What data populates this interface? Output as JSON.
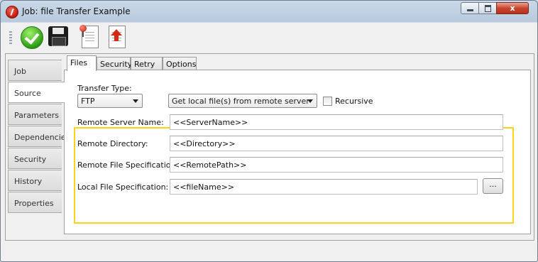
{
  "window": {
    "title": "Job: file Transfer Example",
    "close_label": "x"
  },
  "toolbar": {
    "buttons": [
      "ok-icon",
      "save-icon",
      "document-pin-icon",
      "document-upload-icon"
    ]
  },
  "side_tabs": [
    "Job",
    "Source",
    "Parameters",
    "Dependencies",
    "Security",
    "History",
    "Properties"
  ],
  "active_side_tab": "Source",
  "top_tabs": [
    "Files",
    "Security",
    "Retry",
    "Options"
  ],
  "active_top_tab": "Files",
  "form": {
    "transfer_type_label": "Transfer Type:",
    "transfer_type_value": "FTP",
    "direction_value": "Get local file(s) from remote server",
    "recursive_label": "Recursive",
    "recursive_checked": false,
    "fields": [
      {
        "label": "Remote Server Name:",
        "value": "<<ServerName>>"
      },
      {
        "label": "Remote Directory:",
        "value": "<<Directory>>"
      },
      {
        "label": "Remote File Specification:",
        "value": "<<RemotePath>>"
      },
      {
        "label": "Local File Specification:",
        "value": "<<fileName>>"
      }
    ],
    "browse_label": "..."
  },
  "colors": {
    "highlight_border": "#ffd21e",
    "window_frame": "#b9cade"
  }
}
